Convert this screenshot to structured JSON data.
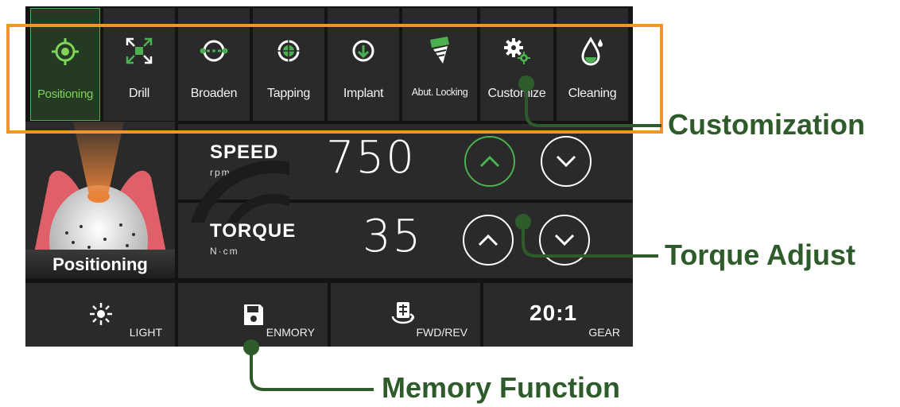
{
  "tabs": [
    {
      "label": "Positioning",
      "icon": "target-icon",
      "active": true
    },
    {
      "label": "Drill",
      "icon": "expand-arrows-icon",
      "active": false
    },
    {
      "label": "Broaden",
      "icon": "broaden-icon",
      "active": false
    },
    {
      "label": "Tapping",
      "icon": "tapping-icon",
      "active": false
    },
    {
      "label": "Implant",
      "icon": "implant-icon",
      "active": false
    },
    {
      "label": "Abut. Locking",
      "icon": "abutment-screw-icon",
      "active": false
    },
    {
      "label": "Customize",
      "icon": "gears-icon",
      "active": false
    },
    {
      "label": "Cleaning",
      "icon": "water-drop-icon",
      "active": false
    }
  ],
  "preview": {
    "label": "Positioning"
  },
  "speed": {
    "name": "SPEED",
    "unit": "rpm",
    "value": "750"
  },
  "torque": {
    "name": "TORQUE",
    "unit": "N·cm",
    "value": "35"
  },
  "bottom": {
    "light": "LIGHT",
    "memory": "ENMORY",
    "fwdrev": "FWD/REV",
    "gear_ratio": "20:1",
    "gear": "GEAR"
  },
  "callouts": {
    "customization": "Customization",
    "torque_adjust": "Torque Adjust",
    "memory_function": "Memory Function"
  },
  "colors": {
    "accent_green": "#4caf50",
    "active_label": "#7ed35a",
    "highlight_orange": "#f29528",
    "callout_green": "#2e5b2a",
    "gum_pink": "#e0606a",
    "drill_orange": "#e8843a"
  }
}
